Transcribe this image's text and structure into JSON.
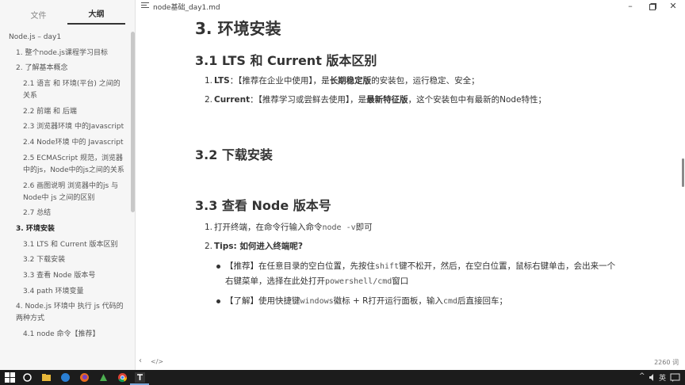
{
  "window": {
    "title": "node基础_day1.md"
  },
  "sidebar": {
    "tabs": [
      "文件",
      "大纲"
    ],
    "outline": [
      {
        "label": "Node.js – day1",
        "level": 0
      },
      {
        "label": "1. 整个node.js课程学习目标",
        "level": 1
      },
      {
        "label": "2. 了解基本概念",
        "level": 1
      },
      {
        "label": "2.1 语言 和 环境(平台) 之间的关系",
        "level": 2
      },
      {
        "label": "2.2 前端 和 后端",
        "level": 2
      },
      {
        "label": "2.3 浏览器环境 中的Javascript",
        "level": 2
      },
      {
        "label": "2.4 Node环境 中的 Javascript",
        "level": 2
      },
      {
        "label": "2.5 ECMAScript 规范，浏览器中的js，Node中的js之间的关系",
        "level": 2
      },
      {
        "label": "2.6 画图说明 浏览器中的js 与Node中 js 之间的区别",
        "level": 2
      },
      {
        "label": "2.7 总结",
        "level": 2
      },
      {
        "label": "3. 环境安装",
        "level": 1,
        "current": true
      },
      {
        "label": "3.1 LTS 和 Current 版本区别",
        "level": 2
      },
      {
        "label": "3.2 下载安装",
        "level": 2
      },
      {
        "label": "3.3 查看 Node 版本号",
        "level": 2
      },
      {
        "label": "3.4 path 环境变量",
        "level": 2
      },
      {
        "label": "4. Node.js 环境中 执行 js 代码的两种方式",
        "level": 1
      },
      {
        "label": "4.1 node 命令【推荐】",
        "level": 2
      }
    ]
  },
  "doc": {
    "h_install": "3. 环境安装",
    "h_31": "3.1 LTS 和 Current 版本区别",
    "lts_label": "LTS",
    "lts_text_a": "：【推荐在企业中使用】，是",
    "lts_bold": "长期稳定版",
    "lts_text_b": "的安装包，运行稳定、安全；",
    "cur_label": "Current",
    "cur_text_a": "：【推荐学习或尝鲜去使用】，是",
    "cur_bold": "最新特征版",
    "cur_text_b": "，这个安装包中有最新的Node特性；",
    "h_32": "3.2 下载安装",
    "h_33": "3.3 查看 Node 版本号",
    "step1_a": "打开终端，在命令行输入命令",
    "step1_code": "node -v",
    "step1_b": "即可",
    "tips": "Tips: 如何进入终端呢?",
    "b1_a": "【推荐】在任意目录的空白位置，先按住",
    "b1_code1": "shift",
    "b1_b": "键不松开，然后，在空白位置，鼠标右键单击，会出来一个右键菜单，选择在此处打开",
    "b1_code2": "powershell/cmd",
    "b1_c": "窗口",
    "b2_a": "【了解】使用快捷键",
    "b2_code1": "windows",
    "b2_b": "徽标 + R打开运行面板，输入",
    "b2_code2": "cmd",
    "b2_c": "后直接回车；"
  },
  "status": {
    "word_count": "2260 词",
    "nav_back": "‹",
    "source_toggle": "</>"
  },
  "taskbar": {
    "ime": "英"
  }
}
